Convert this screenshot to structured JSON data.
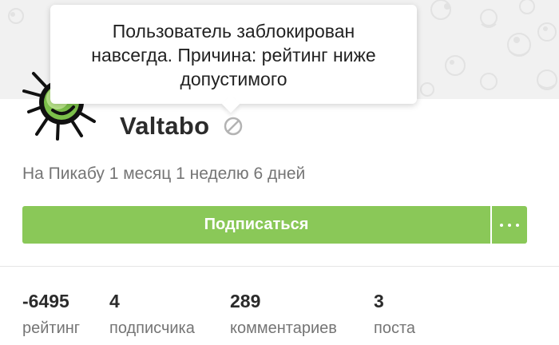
{
  "tooltip": {
    "line1": "Пользователь заблокирован",
    "line2": "навсегда. Причина: рейтинг ниже",
    "line3": "допустимого"
  },
  "profile": {
    "username": "Valtabo",
    "member_since": "На Пикабу 1 месяц 1 неделю 6 дней",
    "status_icon": "blocked-icon",
    "avatar_icon": "green-sun-creature"
  },
  "actions": {
    "subscribe_label": "Подписаться",
    "more_icon": "ellipsis-icon",
    "accent_color": "#8ac858"
  },
  "stats": [
    {
      "value": "-6495",
      "label": "рейтинг"
    },
    {
      "value": "4",
      "label": "подписчика"
    },
    {
      "value": "289",
      "label": "комментариев"
    },
    {
      "value": "3",
      "label": "поста"
    }
  ]
}
